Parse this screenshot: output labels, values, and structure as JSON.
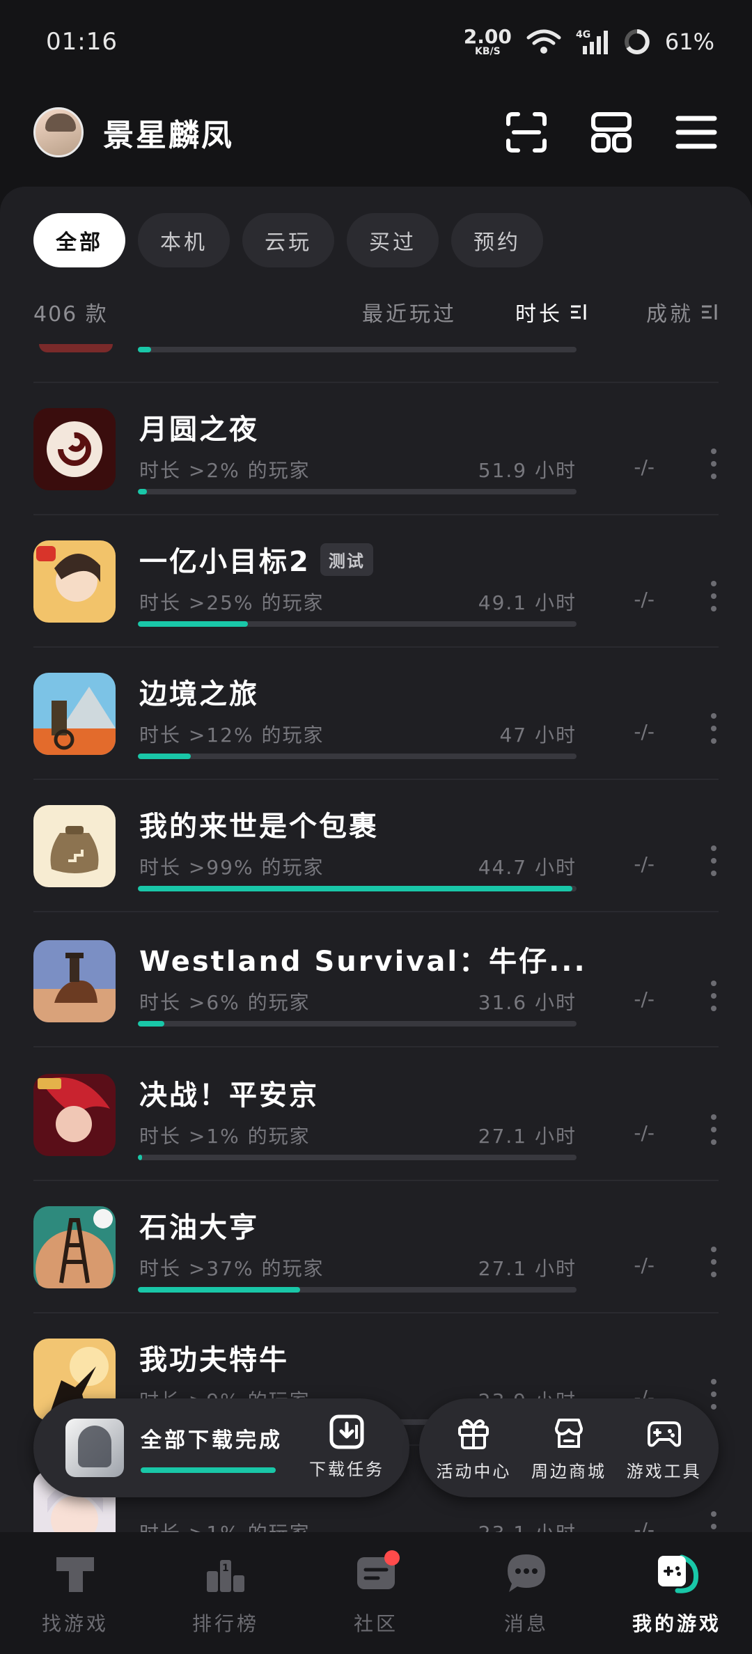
{
  "status_bar": {
    "time": "01:16",
    "net_speed_value": "2.00",
    "net_speed_unit": "KB/S",
    "battery": "61%",
    "icons": [
      "wifi-icon",
      "signal-4g-icon",
      "battery-ring-icon"
    ]
  },
  "header": {
    "username": "景星麟凤",
    "icons": [
      "scan-icon",
      "grid-icon",
      "menu-icon"
    ]
  },
  "filters": {
    "items": [
      "全部",
      "本机",
      "云玩",
      "买过",
      "预约"
    ],
    "active": "全部"
  },
  "sort_bar": {
    "count": "406 款",
    "recent": "最近玩过",
    "duration": "时长",
    "achievement": "成就"
  },
  "games": [
    {
      "title": "月圆之夜",
      "badge": "",
      "subtitle": "时长 >2% 的玩家",
      "hours": "51.9 小时",
      "achievement": "-/-",
      "progress": 0.02
    },
    {
      "title": "一亿小目标2",
      "badge": "测试",
      "subtitle": "时长 >25% 的玩家",
      "hours": "49.1 小时",
      "achievement": "-/-",
      "progress": 0.25
    },
    {
      "title": "边境之旅",
      "badge": "",
      "subtitle": "时长 >12% 的玩家",
      "hours": "47 小时",
      "achievement": "-/-",
      "progress": 0.12
    },
    {
      "title": "我的来世是个包裹",
      "badge": "",
      "subtitle": "时长 >99% 的玩家",
      "hours": "44.7 小时",
      "achievement": "-/-",
      "progress": 0.99
    },
    {
      "title": "Westland Survival：牛仔...",
      "badge": "",
      "subtitle": "时长 >6% 的玩家",
      "hours": "31.6 小时",
      "achievement": "-/-",
      "progress": 0.06
    },
    {
      "title": "决战！平安京",
      "badge": "",
      "subtitle": "时长 >1% 的玩家",
      "hours": "27.1 小时",
      "achievement": "-/-",
      "progress": 0.01
    },
    {
      "title": "石油大亨",
      "badge": "",
      "subtitle": "时长 >37% 的玩家",
      "hours": "27.1 小时",
      "achievement": "-/-",
      "progress": 0.37
    },
    {
      "title": "我功夫特牛",
      "badge": "",
      "subtitle": "时长 >9% 的玩家",
      "hours": "23.9 小时",
      "achievement": "-/-",
      "progress": 0.09
    },
    {
      "title": "",
      "badge": "",
      "subtitle": "时长 >1% 的玩家",
      "hours": "23.1 小时",
      "achievement": "-/-",
      "progress": 0.01
    }
  ],
  "download": {
    "status": "全部下载完成",
    "task_label": "下载任务",
    "progress": 1.0
  },
  "tools": [
    {
      "label": "活动中心",
      "icon": "gift-icon"
    },
    {
      "label": "周边商城",
      "icon": "shop-icon"
    },
    {
      "label": "游戏工具",
      "icon": "gamepad-icon"
    }
  ],
  "bottom_nav": [
    {
      "label": "找游戏",
      "icon": "find-game-icon"
    },
    {
      "label": "排行榜",
      "icon": "ranking-icon"
    },
    {
      "label": "社区",
      "icon": "community-icon"
    },
    {
      "label": "消息",
      "icon": "message-icon"
    },
    {
      "label": "我的游戏",
      "icon": "my-games-icon"
    }
  ],
  "colors": {
    "accent": "#19c7a8",
    "background": "#141416",
    "panel": "#1f1f23",
    "badge_red": "#ff4b4b"
  }
}
